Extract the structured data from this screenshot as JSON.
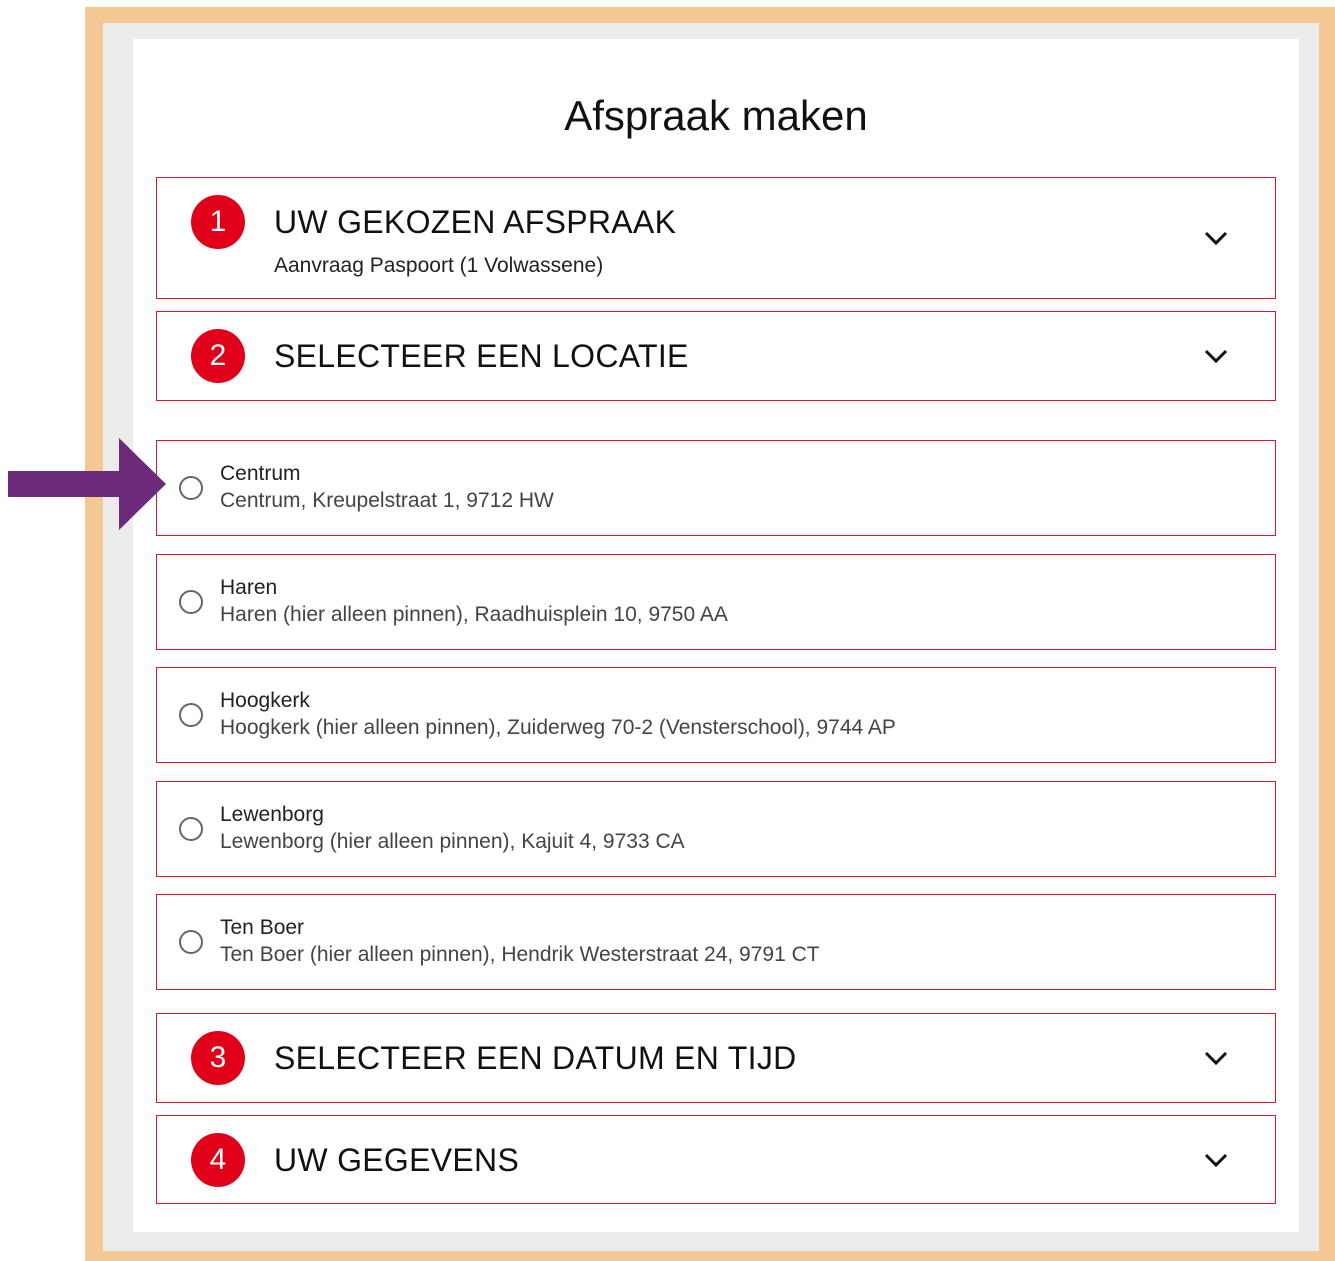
{
  "page": {
    "title": "Afspraak maken"
  },
  "steps": [
    {
      "number": "1",
      "title": "UW GEKOZEN AFSPRAAK",
      "subtitle": "Aanvraag Paspoort (1 Volwassene)"
    },
    {
      "number": "2",
      "title": "SELECTEER EEN LOCATIE"
    },
    {
      "number": "3",
      "title": "SELECTEER EEN DATUM EN TIJD"
    },
    {
      "number": "4",
      "title": "UW GEGEVENS"
    }
  ],
  "locations": [
    {
      "name": "Centrum",
      "address": "Centrum, Kreupelstraat 1, 9712 HW",
      "selected": false
    },
    {
      "name": "Haren",
      "address": "Haren (hier alleen pinnen), Raadhuisplein 10, 9750 AA",
      "selected": false
    },
    {
      "name": "Hoogkerk",
      "address": "Hoogkerk (hier alleen pinnen), Zuiderweg 70-2 (Vensterschool), 9744 AP",
      "selected": false
    },
    {
      "name": "Lewenborg",
      "address": "Lewenborg (hier alleen pinnen), Kajuit 4, 9733 CA",
      "selected": false
    },
    {
      "name": "Ten Boer",
      "address": "Ten Boer (hier alleen pinnen), Hendrik Westerstraat 24, 9791 CT",
      "selected": false
    }
  ],
  "colors": {
    "accent": "#e00019",
    "border": "#d9192b",
    "frame": "#f4c892",
    "arrow": "#6b2a7a"
  }
}
